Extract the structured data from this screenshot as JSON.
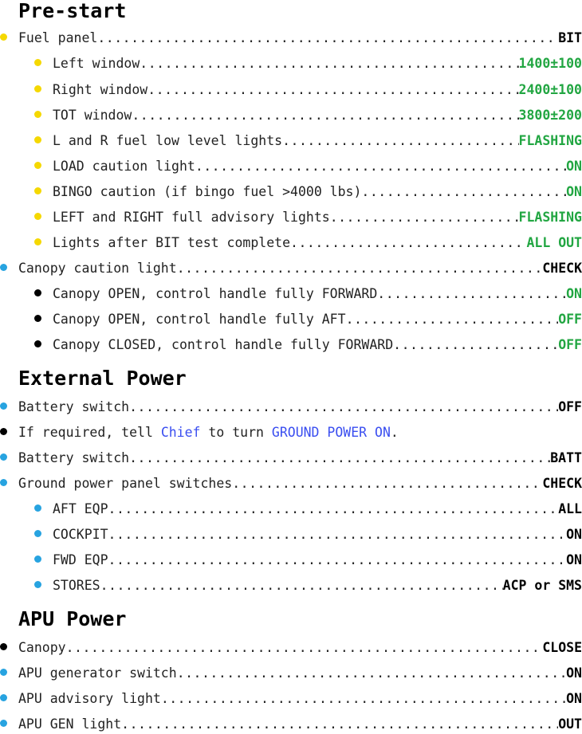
{
  "sections": [
    {
      "title": "Pre-start"
    },
    {
      "title": "External Power"
    },
    {
      "title": "APU Power"
    }
  ],
  "prestart": [
    {
      "label": "Fuel panel",
      "value": "BIT"
    },
    {
      "label": "Left window",
      "value": "1400±100"
    },
    {
      "label": "Right window",
      "value": "2400±100"
    },
    {
      "label": "TOT window",
      "value": "3800±200"
    },
    {
      "label": "L and R fuel low level lights",
      "value": "FLASHING"
    },
    {
      "label": "LOAD caution light",
      "value": "ON"
    },
    {
      "label": "BINGO caution (if bingo fuel >4000 lbs)",
      "value": "ON"
    },
    {
      "label": "LEFT and RIGHT full advisory lights",
      "value": "FLASHING"
    },
    {
      "label": "Lights after BIT test complete",
      "value": "ALL OUT"
    },
    {
      "label": "Canopy caution light",
      "value": "CHECK"
    },
    {
      "label": "Canopy OPEN, control handle fully FORWARD",
      "value": "ON"
    },
    {
      "label": "Canopy OPEN, control handle fully AFT",
      "value": "OFF"
    },
    {
      "label": "Canopy CLOSED, control handle fully FORWARD",
      "value": "OFF"
    }
  ],
  "external": [
    {
      "label": "Battery switch",
      "value": "OFF"
    },
    {
      "text_pre": "If required, tell ",
      "chief": "Chief",
      "text_mid": " to turn ",
      "ground": "GROUND POWER ON",
      "text_post": "."
    },
    {
      "label": "Battery switch",
      "value": "BATT"
    },
    {
      "label": "Ground power panel switches",
      "value": "CHECK"
    },
    {
      "label": "AFT EQP",
      "value": "ALL"
    },
    {
      "label": "COCKPIT",
      "value": "ON"
    },
    {
      "label": "FWD EQP",
      "value": "ON"
    },
    {
      "label": "STORES",
      "value": "ACP or SMS"
    }
  ],
  "apu": [
    {
      "label": "Canopy",
      "value": "CLOSE"
    },
    {
      "label": "APU generator switch",
      "value": "ON"
    },
    {
      "label": "APU advisory light",
      "value": "ON"
    },
    {
      "label": "APU GEN light",
      "value": "OUT"
    }
  ],
  "colors": {
    "value_green": "#22a642",
    "link_blue": "#3a4ef0",
    "bullet_yellow": "#f5d800",
    "bullet_blue": "#27a3e0"
  }
}
